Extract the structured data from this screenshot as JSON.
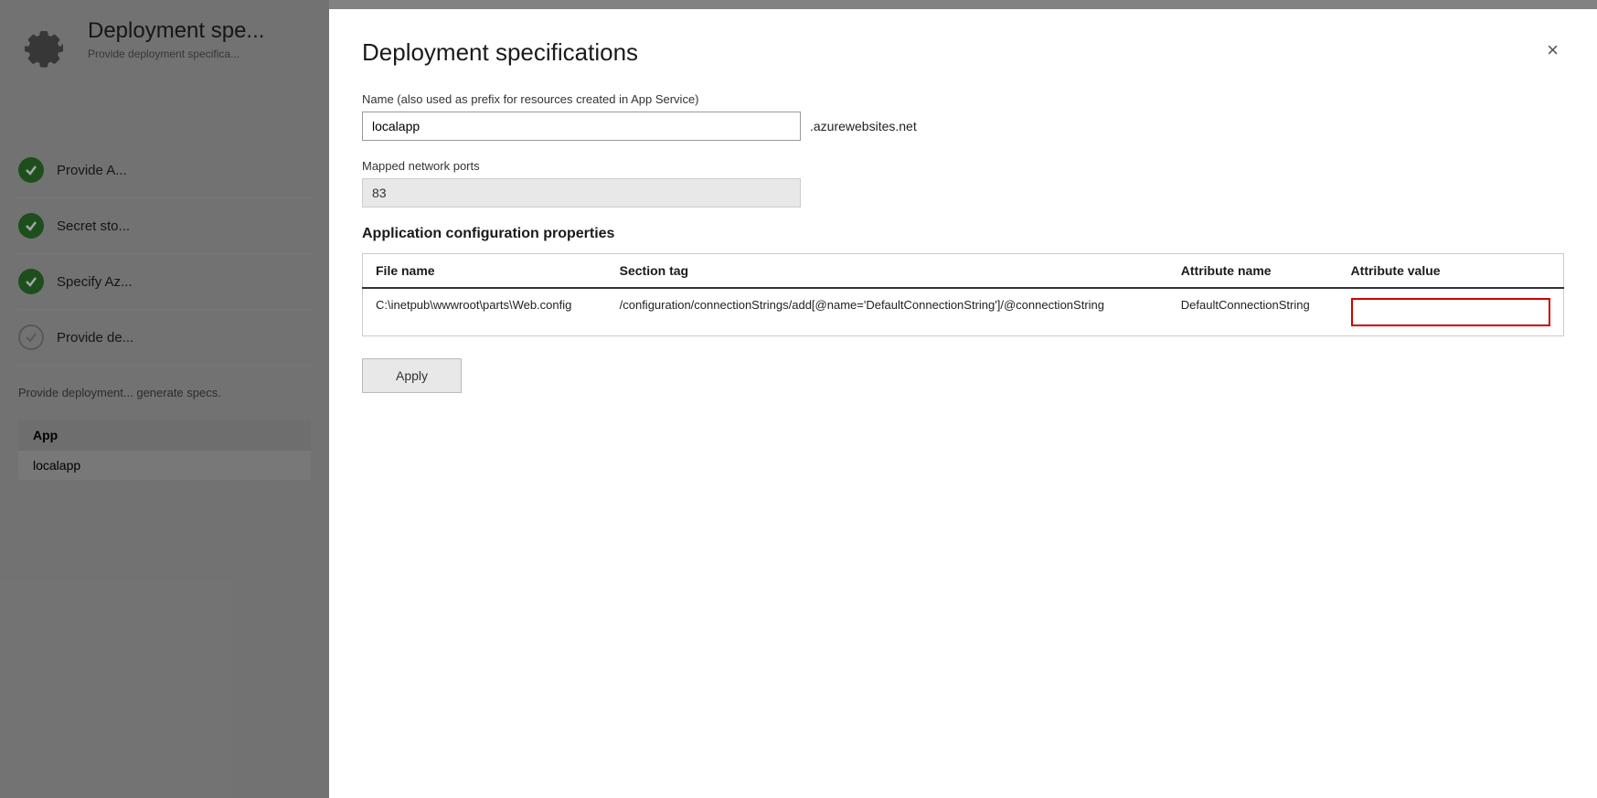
{
  "background": {
    "title": "Deployment spe...",
    "subtitle": "Provide deployment specifica...",
    "steps": [
      {
        "id": "step1",
        "label": "Provide A...",
        "status": "complete"
      },
      {
        "id": "step2",
        "label": "Secret sto...",
        "status": "complete"
      },
      {
        "id": "step3",
        "label": "Specify Az...",
        "status": "complete"
      },
      {
        "id": "step4",
        "label": "Provide de...",
        "status": "outline"
      }
    ],
    "description": "Provide deployment... generate specs.",
    "table_header": "App",
    "table_row": "localapp"
  },
  "modal": {
    "title": "Deployment specifications",
    "close_label": "×",
    "name_label": "Name (also used as prefix for resources created in App Service)",
    "name_value": "localapp",
    "domain_suffix": ".azurewebsites.net",
    "ports_label": "Mapped network ports",
    "ports_value": "83",
    "config_section_title": "Application configuration properties",
    "table_headers": {
      "file_name": "File name",
      "section_tag": "Section tag",
      "attribute_name": "Attribute name",
      "attribute_value": "Attribute value"
    },
    "table_rows": [
      {
        "file_name": "C:\\inetpub\\wwwroot\\parts\\Web.config",
        "section_tag": "/configuration/connectionStrings/add[@name='DefaultConnectionString']/@connectionString",
        "attribute_name": "DefaultConnectionString",
        "attribute_value": ""
      }
    ],
    "apply_label": "Apply"
  }
}
